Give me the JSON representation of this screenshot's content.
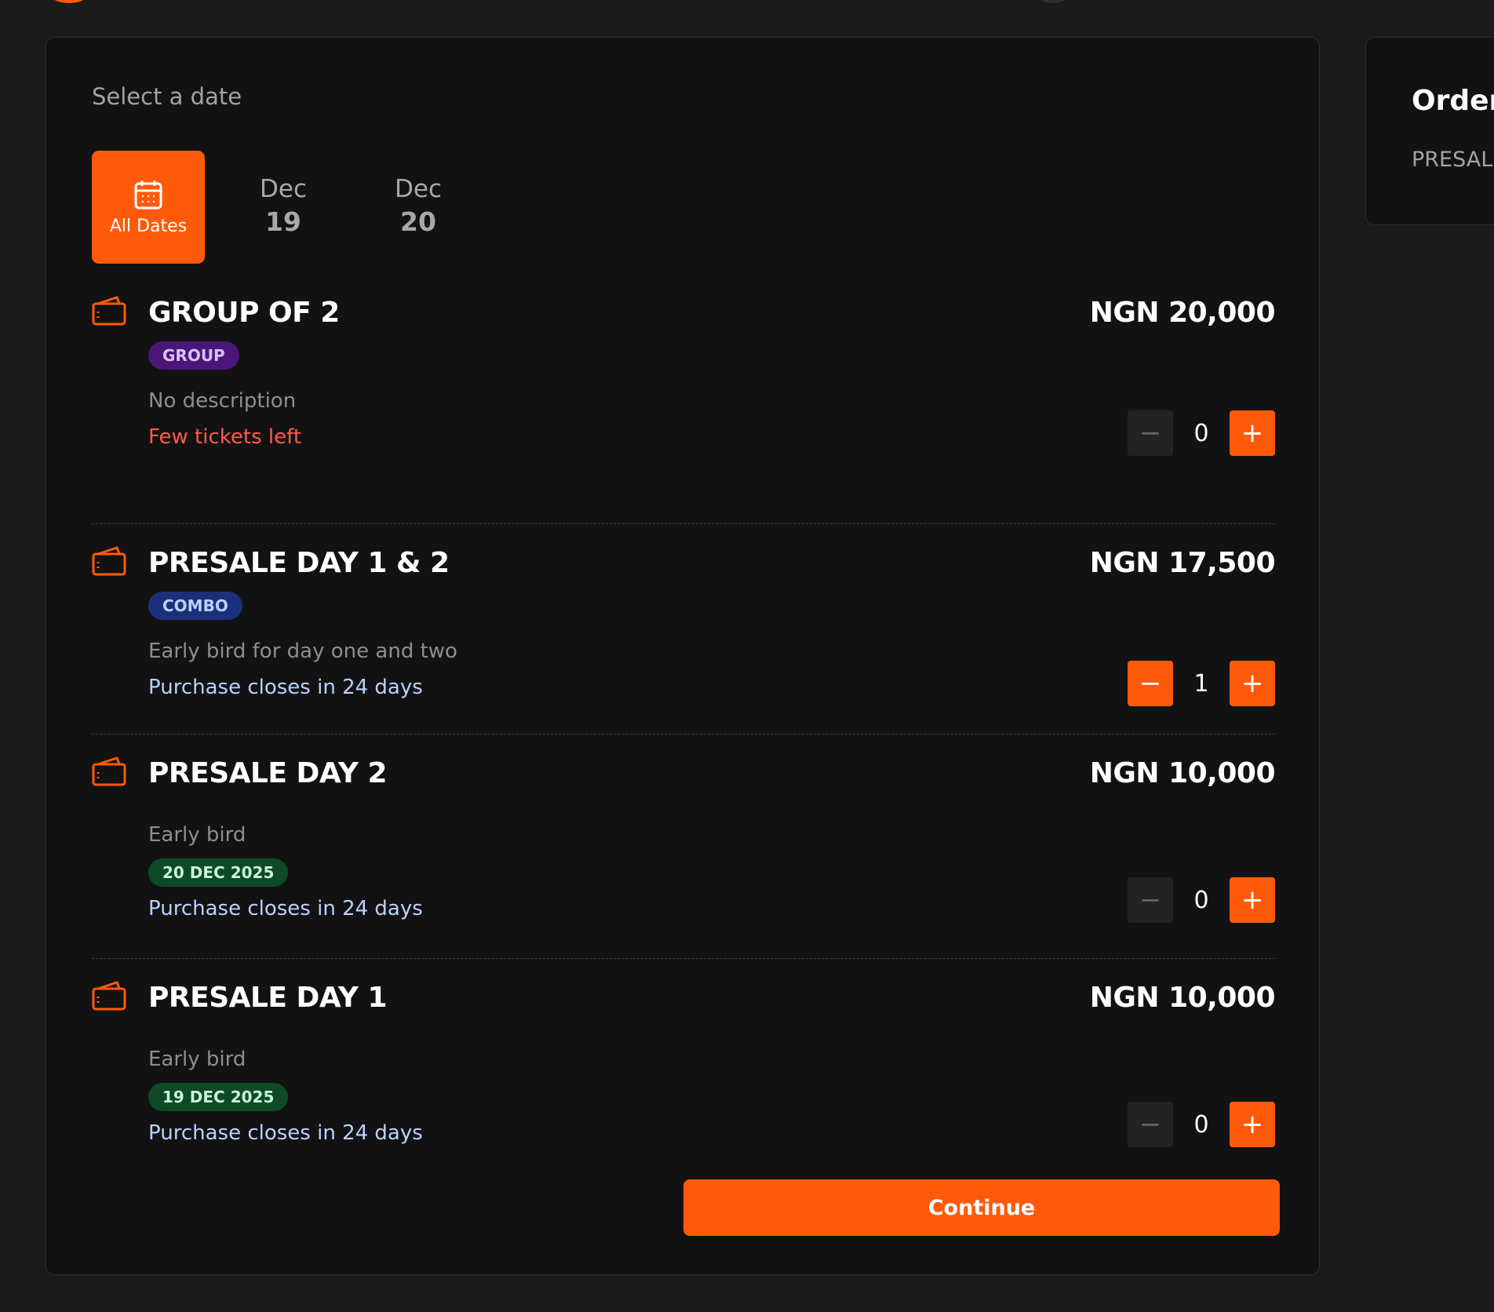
{
  "header": {
    "select_label": "Select a date"
  },
  "date_tabs": [
    {
      "label": "All Dates",
      "icon": "calendar-icon",
      "active": true
    },
    {
      "month": "Dec",
      "day": "19",
      "active": false
    },
    {
      "month": "Dec",
      "day": "20",
      "active": false
    }
  ],
  "tickets": [
    {
      "title": "GROUP OF 2",
      "price": "NGN 20,000",
      "badge": "GROUP",
      "description": "No description",
      "note": "Few tickets left",
      "quantity": "0"
    },
    {
      "title": "PRESALE DAY 1 & 2",
      "price": "NGN 17,500",
      "badge": "COMBO",
      "description": "Early bird for day one and two",
      "note": "Purchase closes in 24 days",
      "quantity": "1"
    },
    {
      "title": "PRESALE DAY 2",
      "price": "NGN 10,000",
      "description": "Early bird",
      "date_badge": "20 DEC 2025",
      "note": "Purchase closes in 24 days",
      "quantity": "0"
    },
    {
      "title": "PRESALE DAY 1",
      "price": "NGN 10,000",
      "description": "Early bird",
      "date_badge": "19 DEC 2025",
      "note": "Purchase closes in 24 days",
      "quantity": "0"
    }
  ],
  "continue_label": "Continue",
  "order_panel": {
    "title": "Order",
    "subtitle": "PRESALE"
  },
  "colors": {
    "accent": "#ff5a0a",
    "background": "#1b1b1b",
    "panel": "#121212",
    "warning": "#ff5c4a",
    "info": "#b9d2ff"
  }
}
